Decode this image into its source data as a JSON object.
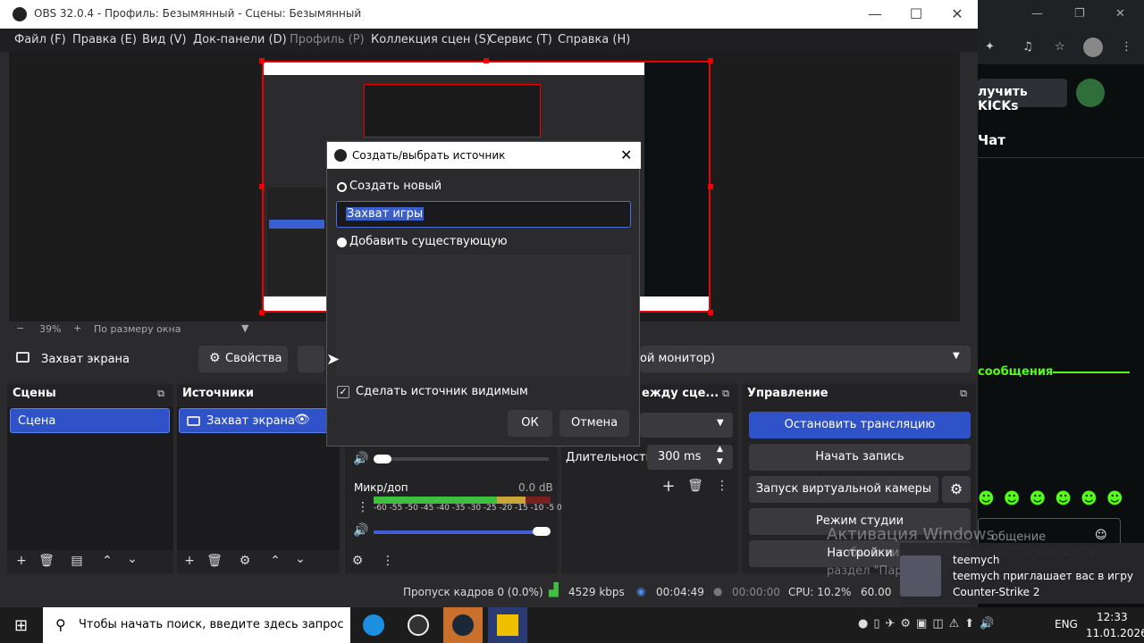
{
  "window": {
    "title": "OBS 32.0.4 - Профиль: Безымянный - Сцены: Безымянный"
  },
  "menu": [
    "Файл (F)",
    "Правка (E)",
    "Вид (V)",
    "Док-панели (D)",
    "Профиль (P)",
    "Коллекция сцен (S)",
    "Сервис (T)",
    "Справка (H)"
  ],
  "zoom": {
    "minus": "−",
    "value": "39%",
    "plus": "+",
    "fit": "По размеру окна"
  },
  "sourcebar": {
    "source": "Захват экрана",
    "properties": "Свойства",
    "monitor": "ой монитор)"
  },
  "docks": {
    "scenes": {
      "title": "Сцены",
      "items": [
        "Сцена"
      ]
    },
    "sources": {
      "title": "Источники",
      "items": [
        "Захват экрана"
      ]
    },
    "transitions": {
      "title": "ежду сце...",
      "duration_label": "Длительность",
      "duration_value": "300 ms"
    },
    "controls": {
      "title": "Управление",
      "buttons": [
        "Остановить трансляцию",
        "Начать запись",
        "Запуск виртуальной камеры",
        "Режим студии",
        "Настройки"
      ]
    }
  },
  "mixer": {
    "mic_label": "Микр/доп",
    "mic_db": "0.0 dB",
    "scale": "-60 -55 -50 -45 -40 -35 -30 -25 -20 -15 -10 -5 0"
  },
  "status": {
    "frames": "Пропуск кадров 0 (0.0%)",
    "bitrate": "4529 kbps",
    "stream_time": "00:04:49",
    "rec_time": "00:00:00",
    "cpu": "CPU: 10.2%",
    "fps": "60.00"
  },
  "dialog": {
    "title": "Создать/выбрать источник",
    "create_new": "Создать новый",
    "name_value": "Захват игры",
    "add_existing": "Добавить существующую",
    "visible_label": "Сделать источник видимым",
    "ok": "ОК",
    "cancel": "Отмена"
  },
  "browser": {
    "kicks": "лучить KICKs",
    "chat": "Чат",
    "messages": "сообщения",
    "input_placeholder": "общение"
  },
  "watermark": {
    "line1": "Активация Windows",
    "line2": "тобы активировать Windows, перейдите в",
    "line3": "раздел \"Параметры\""
  },
  "toast": {
    "user": "teemych",
    "msg1": "teemych приглашает вас в игру",
    "msg2": "Counter-Strike 2"
  },
  "taskbar": {
    "search": "Чтобы начать поиск, введите здесь запрос",
    "lang": "ENG",
    "time": "12:33",
    "date": "11.01.2026"
  }
}
